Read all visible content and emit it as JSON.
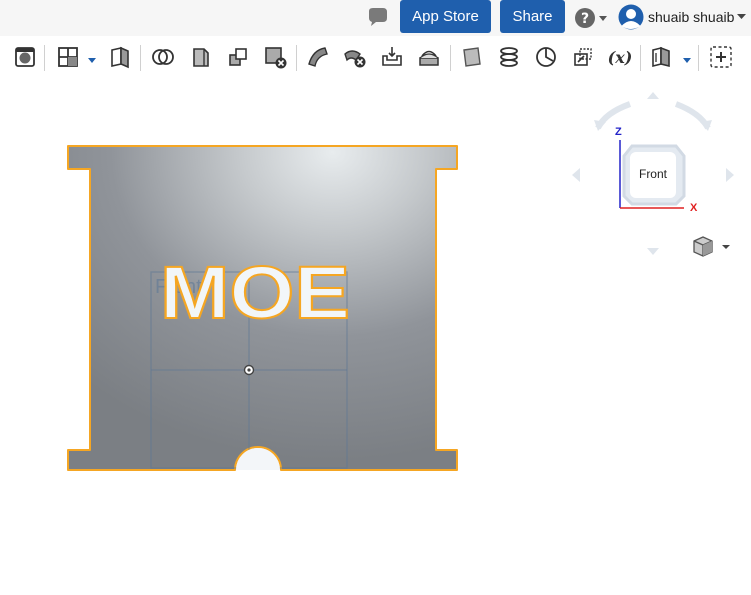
{
  "header": {
    "app_store_label": "App Store",
    "share_label": "Share",
    "help_icon": "question-circle-icon",
    "user_name": "shuaib shuaib"
  },
  "toolbar": {
    "tools": [
      "render-mode",
      "view-layout",
      "section-view",
      "boolean",
      "extrude",
      "revolve",
      "delete-part",
      "sweep",
      "delete-face",
      "fillet",
      "shell",
      "plane",
      "helix",
      "mate-connector",
      "transform",
      "variable",
      "part-studio-feature",
      "insert"
    ],
    "variable_label": "(x)"
  },
  "viewport": {
    "sketch_plane_label": "Front",
    "part_text": "MOE",
    "accent_color": "#f5a623",
    "part_color": "#8a8e92"
  },
  "viewcube": {
    "face_label": "Front",
    "z_label": "Z",
    "x_label": "X"
  }
}
